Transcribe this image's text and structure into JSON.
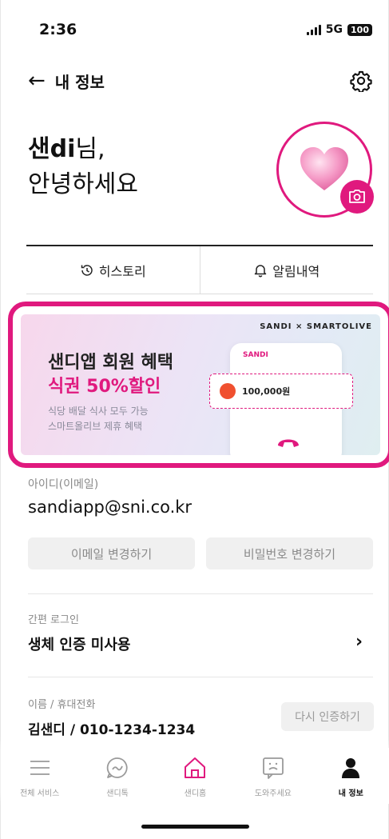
{
  "status": {
    "time": "2:36",
    "network": "5G",
    "battery": "100"
  },
  "header": {
    "title": "내 정보"
  },
  "greeting": {
    "name": "샌di",
    "suffix": "님,",
    "line2": "안녕하세요"
  },
  "tabs": [
    {
      "label": "히스토리"
    },
    {
      "label": "알림내역"
    }
  ],
  "banner": {
    "brand": "SANDI × SMARTOLIVE",
    "title": "샌디앱 회원 혜택",
    "highlight": "식권 50%할인",
    "sub1": "식당 배달 식사 모두 가능",
    "sub2": "스마트올리브 제휴 혜택",
    "phone_brand": "SANDI",
    "coupon_amount": "100,000원"
  },
  "account": {
    "id_label": "아이디(이메일)",
    "id_value": "sandiapp@sni.co.kr",
    "change_email": "이메일 변경하기",
    "change_password": "비밀번호 변경하기"
  },
  "easy_login": {
    "label": "간편 로그인",
    "value": "생체 인증 미사용"
  },
  "contact": {
    "label": "이름 / 휴대전화",
    "value": "김샌디 / 010-1234-1234",
    "reauth": "다시 인증하기"
  },
  "nav": [
    {
      "label": "전체 서비스",
      "icon": "menu-icon"
    },
    {
      "label": "샌디톡",
      "icon": "chat-icon"
    },
    {
      "label": "샌디홈",
      "icon": "home-icon"
    },
    {
      "label": "도와주세요",
      "icon": "help-icon"
    },
    {
      "label": "내 정보",
      "icon": "person-icon"
    }
  ],
  "colors": {
    "accent": "#e0197e"
  }
}
